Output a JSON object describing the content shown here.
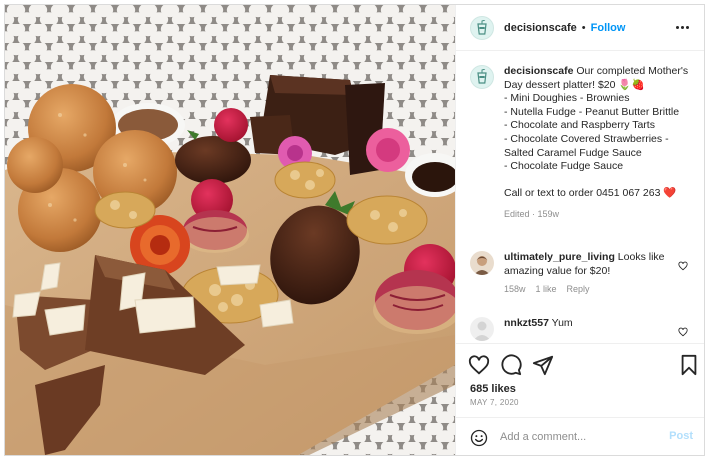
{
  "post": {
    "image_alt": "Mother's Day dessert platter with doughnuts, brownies, strawberries, tarts and peanut brittle on a wooden board",
    "author": {
      "username": "decisionscafe",
      "follow_label": "Follow",
      "avatar_icon": "drink-cup-icon"
    },
    "more_icon": "more-options-icon",
    "caption": {
      "username": "decisionscafe",
      "text": "Our completed Mother's Day dessert platter! $20 🌷🍓\n- Mini Doughies - Brownies\n- Nutella Fudge - Peanut Butter Brittle\n- Chocolate and Raspberry Tarts\n- Chocolate Covered Strawberries -\nSalted Caramel Fudge Sauce\n- Chocolate Fudge Sauce\n\nCall or text to order 0451 067 263 ❤️",
      "meta": "Edited · 159w"
    },
    "comments": [
      {
        "username": "ultimately_pure_living",
        "text": "Looks like amazing value for $20!",
        "age": "158w",
        "likes": "1 like",
        "reply": "Reply"
      },
      {
        "username": "nnkzt557",
        "text": "Yum"
      }
    ],
    "actions": {
      "like_icon": "heart-icon",
      "comment_icon": "comment-icon",
      "share_icon": "share-icon",
      "save_icon": "bookmark-icon"
    },
    "likes": "685 likes",
    "date": "MAY 7, 2020",
    "add_comment": {
      "placeholder": "Add a comment...",
      "post_label": "Post",
      "emoji_icon": "emoji-icon"
    },
    "colors": {
      "link_blue": "#0095f6",
      "post_disabled": "#b2dffc",
      "secondary_text": "#8e8e8e",
      "border": "#efefef"
    }
  }
}
